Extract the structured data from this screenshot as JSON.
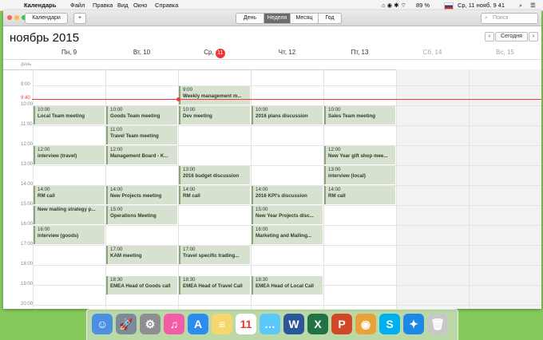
{
  "menubar": {
    "app": "Календарь",
    "items": [
      "Файл",
      "Правка",
      "Вид",
      "Окно",
      "Справка"
    ],
    "battery": "89 %",
    "clock": "Ср, 11 нояб. 9 41"
  },
  "toolbar": {
    "calendars_label": "Календари",
    "add_label": "+",
    "views": [
      "День",
      "Неделя",
      "Месяц",
      "Год"
    ],
    "active_view": "Неделя",
    "search_placeholder": "Поиск"
  },
  "header": {
    "month": "ноябрь",
    "year": "2015",
    "today_label": "Сегодня",
    "prev": "‹",
    "next": "›"
  },
  "days": [
    {
      "label": "Пн, 9"
    },
    {
      "label": "Вт, 10"
    },
    {
      "label": "Ср,",
      "badge": "11"
    },
    {
      "label": "Чт, 12"
    },
    {
      "label": "Пт, 13"
    },
    {
      "label": "Сб, 14"
    },
    {
      "label": "Вс, 15"
    }
  ],
  "allday_label": "день",
  "hours": [
    "9:00",
    "10:00",
    "11:00",
    "12:00",
    "13:00",
    "14:00",
    "15:00",
    "16:00",
    "17:00",
    "18:00",
    "19:00",
    "20:00"
  ],
  "now_label": "9:40",
  "events": [
    {
      "day": 2,
      "start": 9.0,
      "time": "9:00",
      "name": "Weekly management m..."
    },
    {
      "day": 0,
      "start": 10.0,
      "time": "10:00",
      "name": "Local Team meeting"
    },
    {
      "day": 1,
      "start": 10.0,
      "time": "10:00",
      "name": "Goods Team meeting"
    },
    {
      "day": 2,
      "start": 10.0,
      "time": "10:00",
      "name": "Dev meeting"
    },
    {
      "day": 3,
      "start": 10.0,
      "time": "10:00",
      "name": "2016 plans discussion"
    },
    {
      "day": 4,
      "start": 10.0,
      "time": "10:00",
      "name": "Sales Team meeting"
    },
    {
      "day": 1,
      "start": 11.0,
      "time": "11:00",
      "name": "Travel Team meeting"
    },
    {
      "day": 0,
      "start": 12.0,
      "time": "12:00",
      "name": "interview (travel)"
    },
    {
      "day": 1,
      "start": 12.0,
      "time": "12:00",
      "name": "Management Board - K..."
    },
    {
      "day": 4,
      "start": 12.0,
      "time": "12:00",
      "name": "New Year gift shop mee..."
    },
    {
      "day": 2,
      "start": 13.0,
      "time": "13:00",
      "name": "2016 budget discussion"
    },
    {
      "day": 4,
      "start": 13.0,
      "time": "13:00",
      "name": "interview (local)"
    },
    {
      "day": 0,
      "start": 14.0,
      "time": "14:00",
      "name": "RM call"
    },
    {
      "day": 1,
      "start": 14.0,
      "time": "14:00",
      "name": "New Projects meeting"
    },
    {
      "day": 2,
      "start": 14.0,
      "time": "14:00",
      "name": "RM call"
    },
    {
      "day": 3,
      "start": 14.0,
      "time": "14:00",
      "name": "2016 KPI's discussion"
    },
    {
      "day": 4,
      "start": 14.0,
      "time": "14:00",
      "name": "RM call"
    },
    {
      "day": 0,
      "start": 15.0,
      "time": "",
      "name": "New mailing strategy p..."
    },
    {
      "day": 1,
      "start": 15.0,
      "time": "15:00",
      "name": "Operations Meeting"
    },
    {
      "day": 3,
      "start": 15.0,
      "time": "15:00",
      "name": "New Year Projects disc..."
    },
    {
      "day": 0,
      "start": 16.0,
      "time": "16:00",
      "name": "interview (goods)"
    },
    {
      "day": 3,
      "start": 16.0,
      "time": "16:00",
      "name": "Marketing and Mailing..."
    },
    {
      "day": 1,
      "start": 17.0,
      "time": "17:00",
      "name": "KAM meeting"
    },
    {
      "day": 2,
      "start": 17.0,
      "time": "17:00",
      "name": "Travel specific trading..."
    },
    {
      "day": 1,
      "start": 18.5,
      "time": "18:30",
      "name": "EMEA Head of Goods call"
    },
    {
      "day": 2,
      "start": 18.5,
      "time": "18:30",
      "name": "EMEA Head of Travel Call"
    },
    {
      "day": 3,
      "start": 18.5,
      "time": "18:30",
      "name": "EMEA Head of Local Call"
    }
  ],
  "dock": [
    {
      "name": "finder-icon",
      "color": "#4a90e2",
      "glyph": "☺"
    },
    {
      "name": "launchpad-icon",
      "color": "#7d8a99",
      "glyph": "🚀"
    },
    {
      "name": "system-preferences-icon",
      "color": "#8e8e93",
      "glyph": "⚙"
    },
    {
      "name": "itunes-icon",
      "color": "#f25ca8",
      "glyph": "♫"
    },
    {
      "name": "app-store-icon",
      "color": "#2d8cf0",
      "glyph": "A"
    },
    {
      "name": "notes-icon",
      "color": "#f5d76e",
      "glyph": "≡"
    },
    {
      "name": "calendar-icon",
      "color": "#ffffff",
      "glyph": "11"
    },
    {
      "name": "messages-icon",
      "color": "#5ac8fa",
      "glyph": "…"
    },
    {
      "name": "word-icon",
      "color": "#2b579a",
      "glyph": "W"
    },
    {
      "name": "excel-icon",
      "color": "#217346",
      "glyph": "X"
    },
    {
      "name": "powerpoint-icon",
      "color": "#d24726",
      "glyph": "P"
    },
    {
      "name": "chrome-icon",
      "color": "#e9a23b",
      "glyph": "◉"
    },
    {
      "name": "skype-icon",
      "color": "#00aff0",
      "glyph": "S"
    },
    {
      "name": "safari-icon",
      "color": "#1e88e5",
      "glyph": "✦"
    },
    {
      "name": "trash-icon",
      "color": "#c8c8c8",
      "glyph": "🗑"
    }
  ]
}
